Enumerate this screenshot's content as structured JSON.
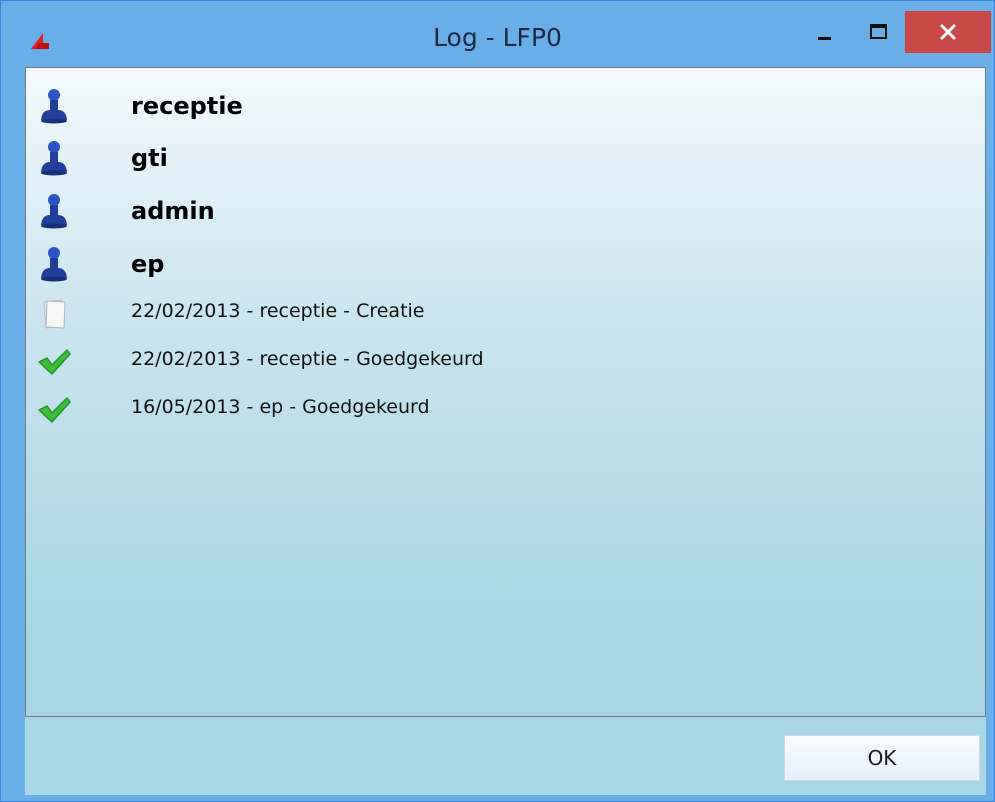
{
  "window": {
    "title": "Log - LFP0",
    "close_glyph": "✕"
  },
  "users": [
    {
      "name": "receptie",
      "icon": "user-icon"
    },
    {
      "name": "gti",
      "icon": "user-icon"
    },
    {
      "name": "admin",
      "icon": "user-icon"
    },
    {
      "name": "ep",
      "icon": "user-icon"
    }
  ],
  "log_entries": [
    {
      "text": "22/02/2013 - receptie - Creatie",
      "icon": "document-icon"
    },
    {
      "text": "22/02/2013 - receptie - Goedgekeurd",
      "icon": "checkmark-icon"
    },
    {
      "text": "16/05/2013 - ep - Goedgekeurd",
      "icon": "checkmark-icon"
    }
  ],
  "footer": {
    "ok_label": "OK"
  },
  "colors": {
    "titlebar": "#6aaee8",
    "close_button": "#c84848",
    "user_icon": "#1f3f9a",
    "check_icon": "#3bbf3b"
  }
}
